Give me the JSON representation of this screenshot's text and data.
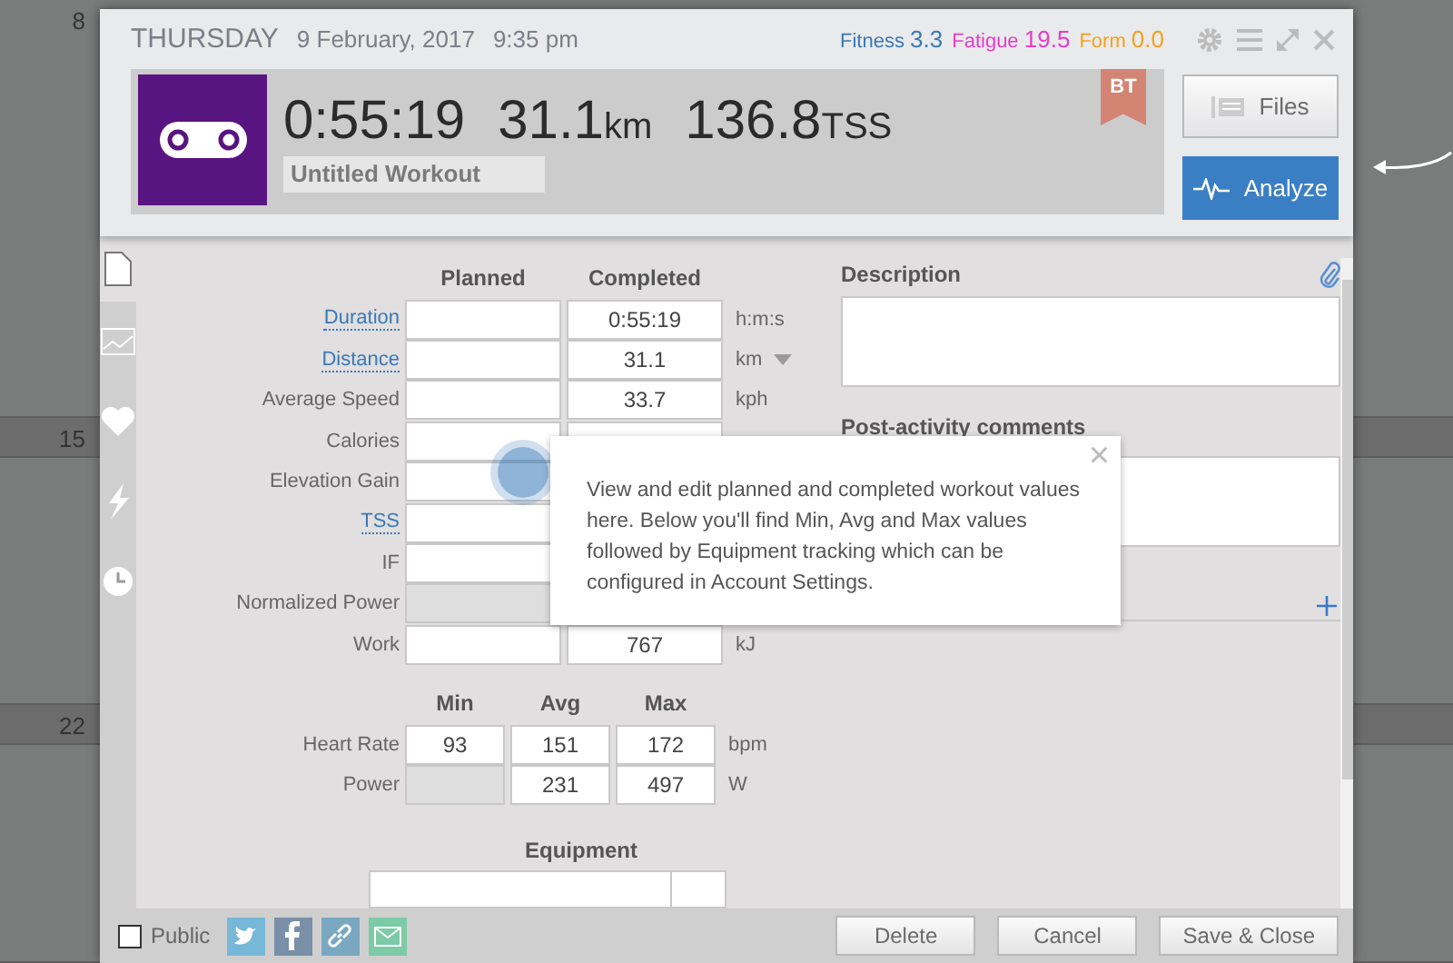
{
  "calendar": {
    "day_numbers": [
      "8",
      "15",
      "22"
    ]
  },
  "header": {
    "day": "THURSDAY",
    "date": "9 February, 2017",
    "time": "9:35 pm",
    "metrics": [
      {
        "label": "Fitness",
        "value": "3.3",
        "color": "#3a78b5"
      },
      {
        "label": "Fatigue",
        "value": "19.5",
        "color": "#e63cc8"
      },
      {
        "label": "Form",
        "value": "0.0",
        "color": "#f4a21c"
      }
    ],
    "summary": {
      "duration": "0:55:19",
      "distance": "31.1",
      "distance_unit": "km",
      "tss": "136.8",
      "tss_unit": "TSS",
      "title": "Untitled Workout",
      "badge": "BT"
    },
    "buttons": [
      {
        "label": "Files",
        "kind": "files"
      },
      {
        "label": "Analyze",
        "kind": "analyze"
      }
    ]
  },
  "sidebar": {
    "items": [
      {
        "kind": "file",
        "selected": true
      },
      {
        "kind": "chart",
        "selected": false
      },
      {
        "kind": "heart",
        "selected": false
      },
      {
        "kind": "bolt",
        "selected": false
      },
      {
        "kind": "clock",
        "selected": false
      }
    ]
  },
  "form": {
    "columns": [
      "Planned",
      "Completed"
    ],
    "rows": [
      {
        "kind": "text",
        "label": "Duration",
        "link": true,
        "completed": "0:55:19",
        "unit": "h:m:s",
        "planned_disabled": false
      },
      {
        "kind": "select",
        "label": "Distance",
        "link": true,
        "completed": "31.1",
        "unit": "km",
        "planned_disabled": false
      },
      {
        "kind": "text",
        "label": "Average Speed",
        "link": false,
        "completed": "33.7",
        "unit": "kph",
        "planned_disabled": false
      },
      {
        "kind": "text",
        "label": "Calories",
        "link": false,
        "planned_disabled": false
      },
      {
        "kind": "covered",
        "label": "Elevation Gain",
        "link": false,
        "planned_disabled": false
      },
      {
        "kind": "covered",
        "label": "TSS",
        "link": true,
        "planned_disabled": false
      },
      {
        "kind": "covered",
        "label": "IF",
        "link": false,
        "planned_disabled": false
      },
      {
        "kind": "covered",
        "label": "Normalized Power",
        "link": false,
        "planned_disabled": true
      },
      {
        "kind": "text",
        "label": "Work",
        "link": false,
        "completed": "767",
        "unit": "kJ",
        "planned_disabled": false
      }
    ],
    "stats_columns": [
      "Min",
      "Avg",
      "Max"
    ],
    "stats": [
      {
        "label": "Heart Rate",
        "min": "93",
        "avg": "151",
        "max": "172",
        "unit": "bpm",
        "min_disabled": false
      },
      {
        "label": "Power",
        "avg": "231",
        "max": "497",
        "unit": "W",
        "min_disabled": true
      }
    ],
    "equipment_title": "Equipment"
  },
  "notes": {
    "description_label": "Description",
    "comments_label": "Post-activity comments"
  },
  "tooltip": {
    "text": "View and edit planned and completed workout values here. Below you'll find Min, Avg and Max values followed by Equipment tracking which can be configured in Account Settings.",
    "close": "×"
  },
  "footer": {
    "public": {
      "label": "Public",
      "checked": false
    },
    "buttons": [
      "Delete",
      "Cancel",
      "Save & Close"
    ]
  }
}
